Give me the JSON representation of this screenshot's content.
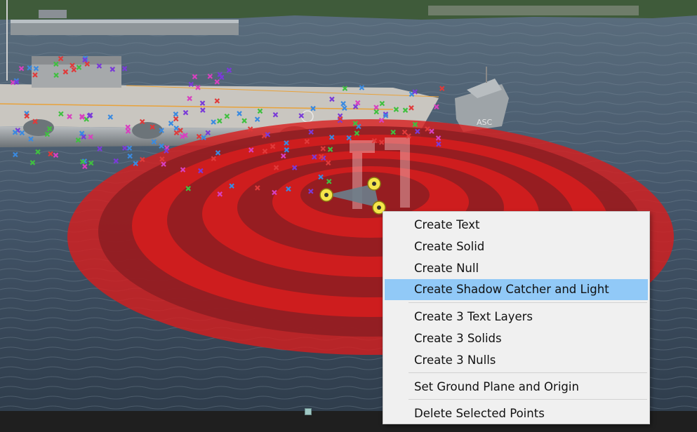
{
  "context_menu": {
    "groups": [
      [
        {
          "label": "Create Text",
          "highlighted": false
        },
        {
          "label": "Create Solid",
          "highlighted": false
        },
        {
          "label": "Create Null",
          "highlighted": false
        },
        {
          "label": "Create Shadow Catcher and Light",
          "highlighted": true
        }
      ],
      [
        {
          "label": "Create 3 Text Layers",
          "highlighted": false
        },
        {
          "label": "Create 3 Solids",
          "highlighted": false
        },
        {
          "label": "Create 3 Nulls",
          "highlighted": false
        }
      ],
      [
        {
          "label": "Set Ground Plane and Origin",
          "highlighted": false
        }
      ],
      [
        {
          "label": "Delete Selected Points",
          "highlighted": false
        }
      ]
    ]
  },
  "scene": {
    "ship_hull_text": "ASC",
    "target_color": "#d81d1d",
    "highlight_color": "#91c9f7",
    "track_point_colors": [
      "#e03a3a",
      "#7a3ad8",
      "#3a8ae0",
      "#40c040",
      "#d840c0"
    ]
  }
}
